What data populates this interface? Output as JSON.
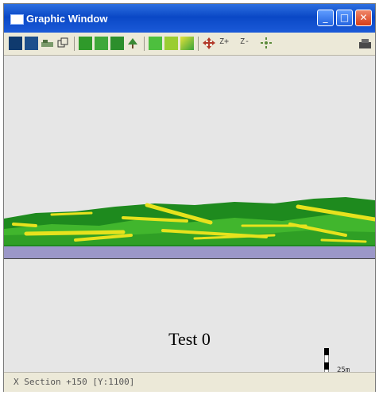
{
  "window": {
    "title": "Graphic Window"
  },
  "toolbar": {
    "zoom_in_label": "Z+",
    "zoom_out_label": "Z-",
    "icons": [
      "map-icon",
      "map-icon",
      "layer-icon",
      "copy-icon",
      "terrain-icon",
      "terrain-icon",
      "terrain-icon",
      "tree-icon",
      "terrain-icon",
      "terrain-icon",
      "terrain-icon",
      "move-icon",
      "zoom-in-icon",
      "zoom-out-icon",
      "pan-icon",
      "print-icon"
    ]
  },
  "canvas": {
    "caption": "Test 0",
    "scale_label": "25m",
    "colors": {
      "background": "#e6e6e6",
      "ground": "#9b97c8",
      "vegetation_dark": "#1e8a1e",
      "vegetation_light": "#41b62d",
      "log": "#e7e21d"
    }
  },
  "status": {
    "text": "X Section +150 [Y:1100]"
  }
}
